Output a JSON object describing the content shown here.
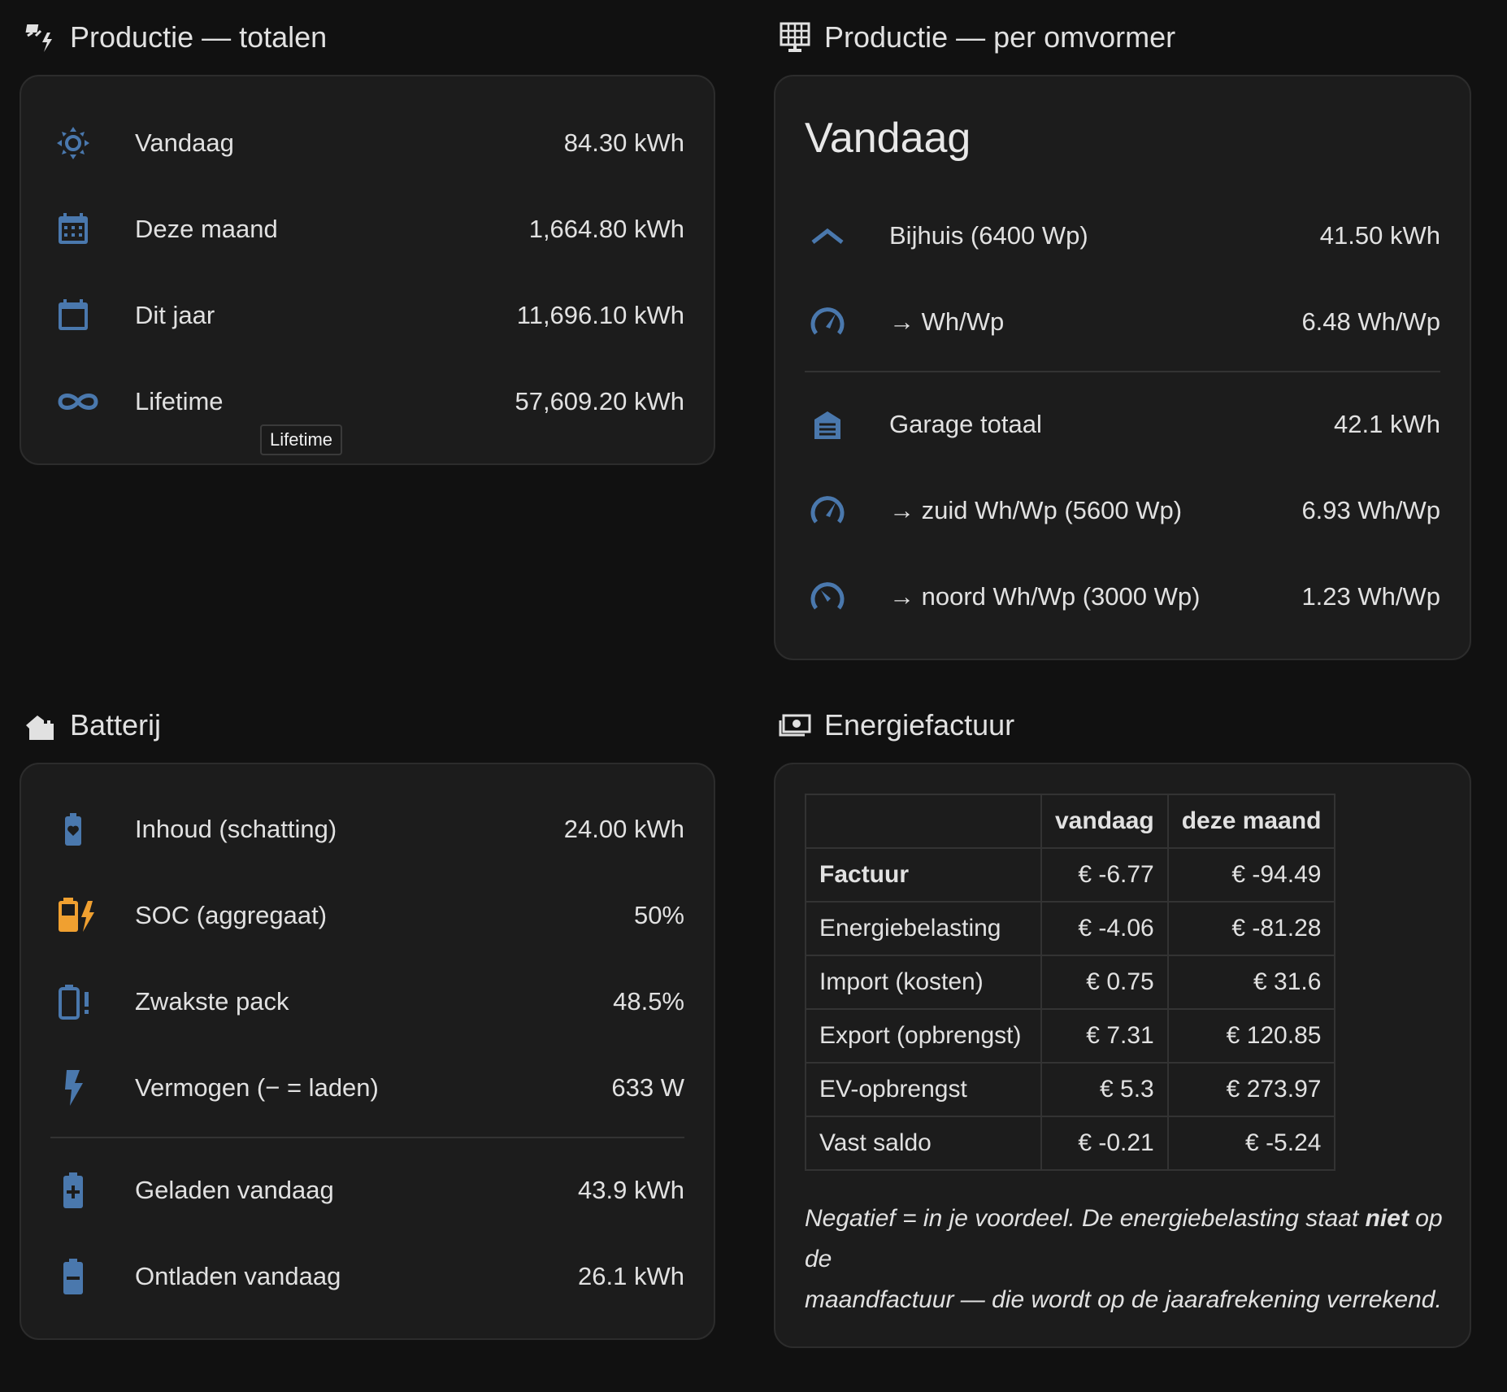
{
  "colors": {
    "icon": "#4a78ad",
    "accent": "#f0a030",
    "card_bg": "#1c1c1c",
    "page_bg": "#111111"
  },
  "totals": {
    "title": "Productie — totalen",
    "header_icon": "solar-power-icon",
    "rows": [
      {
        "icon": "sun-icon",
        "label": "Vandaag",
        "value": "84.30 kWh"
      },
      {
        "icon": "calendar-month-icon",
        "label": "Deze maand",
        "value": "1,664.80 kWh"
      },
      {
        "icon": "calendar-icon",
        "label": "Dit jaar",
        "value": "11,696.10 kWh"
      },
      {
        "icon": "infinity-icon",
        "label": "Lifetime",
        "value": "57,609.20 kWh"
      }
    ],
    "tooltip": "Lifetime"
  },
  "inverter": {
    "title": "Productie — per omvormer",
    "header_icon": "solar-panel-icon",
    "subtitle": "Vandaag",
    "rows": [
      {
        "icon": "roof-icon",
        "label": "Bijhuis (6400 Wp)",
        "value": "41.50 kWh"
      },
      {
        "icon": "gauge-icon",
        "label": "→ Wh/Wp",
        "value": "6.48 Wh/Wp"
      },
      {
        "icon": "garage-icon",
        "label": "Garage totaal",
        "value": "42.1 kWh"
      },
      {
        "icon": "gauge-icon",
        "label": "→ zuid Wh/Wp (5600 Wp)",
        "value": "6.93 Wh/Wp"
      },
      {
        "icon": "gauge-low-icon",
        "label": "→ noord Wh/Wp (3000 Wp)",
        "value": "1.23 Wh/Wp"
      }
    ]
  },
  "battery": {
    "title": "Batterij",
    "header_icon": "home-battery-icon",
    "rows": [
      {
        "icon": "battery-heart-icon",
        "label": "Inhoud (schatting)",
        "value": "24.00 kWh"
      },
      {
        "icon": "battery-charging-icon",
        "label": "SOC (aggregaat)",
        "value": "50%"
      },
      {
        "icon": "battery-alert-icon",
        "label": "Zwakste pack",
        "value": "48.5%"
      },
      {
        "icon": "flash-icon",
        "label": "Vermogen (− = laden)",
        "value": "633 W"
      },
      {
        "icon": "battery-plus-icon",
        "label": "Geladen vandaag",
        "value": "43.9 kWh"
      },
      {
        "icon": "battery-minus-icon",
        "label": "Ontladen vandaag",
        "value": "26.1 kWh"
      }
    ]
  },
  "bill": {
    "title": "Energiefactuur",
    "header_icon": "cash-icon",
    "columns": [
      "",
      "vandaag",
      "deze maand"
    ],
    "rows": [
      {
        "label": "Factuur",
        "today": "€ -6.77",
        "month": "€ -94.49"
      },
      {
        "label": "Energiebelasting",
        "today": "€ -4.06",
        "month": "€ -81.28"
      },
      {
        "label": "Import (kosten)",
        "today": "€ 0.75",
        "month": "€ 31.6"
      },
      {
        "label": "Export (opbrengst)",
        "today": "€ 7.31",
        "month": "€ 120.85"
      },
      {
        "label": "EV-opbrengst",
        "today": "€ 5.3",
        "month": "€ 273.97"
      },
      {
        "label": "Vast saldo",
        "today": "€ -0.21",
        "month": "€ -5.24"
      }
    ],
    "note": {
      "part1": "Negatief = in je voordeel. De energiebelasting staat ",
      "bold": "niet",
      "part2": " op de",
      "part3": "maandfactuur — die wordt op de jaarafrekening verrekend."
    }
  }
}
